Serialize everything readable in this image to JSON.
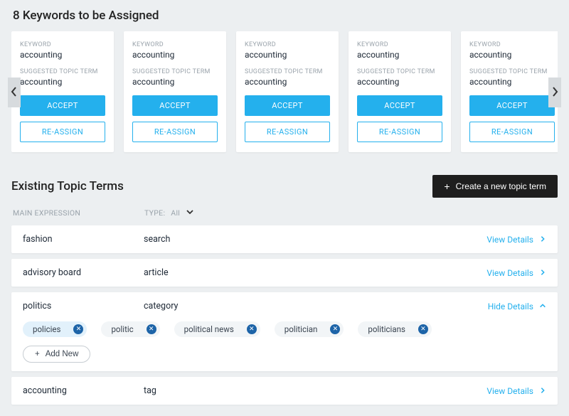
{
  "assign": {
    "title": "8 Keywords to be Assigned",
    "labels": {
      "keyword": "KEYWORD",
      "suggested": "SUGGESTED TOPIC TERM"
    },
    "buttons": {
      "accept": "ACCEPT",
      "reassign": "RE-ASSIGN"
    },
    "cards": [
      {
        "keyword": "accounting",
        "suggested": "accounting"
      },
      {
        "keyword": "accounting",
        "suggested": "accounting"
      },
      {
        "keyword": "accounting",
        "suggested": "accounting"
      },
      {
        "keyword": "accounting",
        "suggested": "accounting"
      },
      {
        "keyword": "accounting",
        "suggested": "accounting"
      }
    ]
  },
  "existing": {
    "title": "Existing Topic Terms",
    "create_label": "Create a new topic term",
    "columns": {
      "main": "MAIN EXPRESSION",
      "type_prefix": "TYPE:",
      "type_value": "All"
    },
    "view_details": "View Details",
    "hide_details": "Hide Details",
    "add_new": "Add New",
    "rows": [
      {
        "main": "fashion",
        "type": "search",
        "expanded": false
      },
      {
        "main": "advisory board",
        "type": "article",
        "expanded": false
      },
      {
        "main": "politics",
        "type": "category",
        "expanded": true,
        "chips": [
          "policies",
          "politic",
          "political news",
          "politician",
          "politicians"
        ],
        "active_chip_index": 0
      },
      {
        "main": "accounting",
        "type": "tag",
        "expanded": false
      }
    ]
  },
  "colors": {
    "accent": "#24b0ed",
    "dark": "#1e1e1e"
  }
}
